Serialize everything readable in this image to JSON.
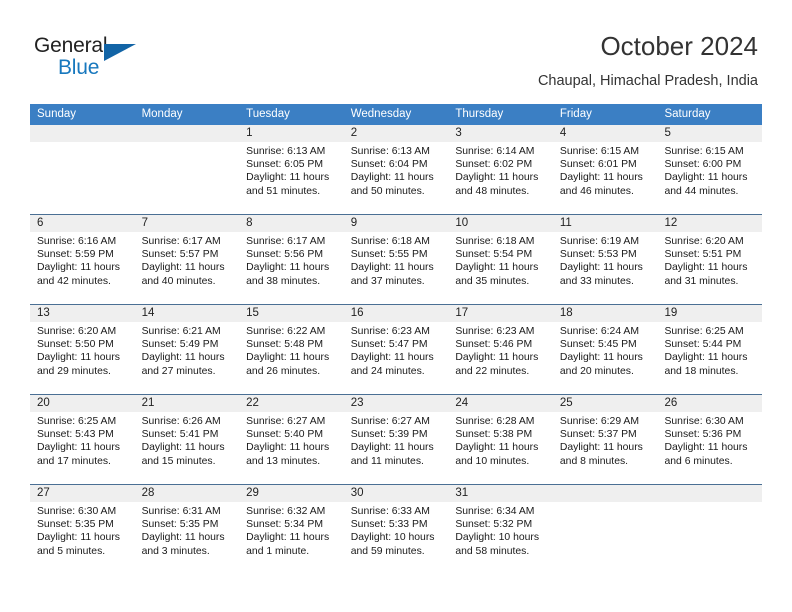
{
  "brand": {
    "name_part1": "General",
    "name_part2": "Blue",
    "logo_icon": "triangle-logo-icon"
  },
  "header": {
    "title": "October 2024",
    "subtitle": "Chaupal, Himachal Pradesh, India"
  },
  "colors": {
    "header_blue": "#3b7fc4",
    "brand_blue": "#1878be",
    "logo_blue": "#1264a6",
    "daynum_band": "#efefef",
    "row_divider": "#4a6f94",
    "text": "#1a1a1a"
  },
  "calendar": {
    "day_headers": [
      "Sunday",
      "Monday",
      "Tuesday",
      "Wednesday",
      "Thursday",
      "Friday",
      "Saturday"
    ],
    "weeks": [
      [
        {
          "day": "",
          "empty": true
        },
        {
          "day": "",
          "empty": true
        },
        {
          "day": "1",
          "sunrise": "Sunrise: 6:13 AM",
          "sunset": "Sunset: 6:05 PM",
          "daylight": "Daylight: 11 hours and 51 minutes."
        },
        {
          "day": "2",
          "sunrise": "Sunrise: 6:13 AM",
          "sunset": "Sunset: 6:04 PM",
          "daylight": "Daylight: 11 hours and 50 minutes."
        },
        {
          "day": "3",
          "sunrise": "Sunrise: 6:14 AM",
          "sunset": "Sunset: 6:02 PM",
          "daylight": "Daylight: 11 hours and 48 minutes."
        },
        {
          "day": "4",
          "sunrise": "Sunrise: 6:15 AM",
          "sunset": "Sunset: 6:01 PM",
          "daylight": "Daylight: 11 hours and 46 minutes."
        },
        {
          "day": "5",
          "sunrise": "Sunrise: 6:15 AM",
          "sunset": "Sunset: 6:00 PM",
          "daylight": "Daylight: 11 hours and 44 minutes."
        }
      ],
      [
        {
          "day": "6",
          "sunrise": "Sunrise: 6:16 AM",
          "sunset": "Sunset: 5:59 PM",
          "daylight": "Daylight: 11 hours and 42 minutes."
        },
        {
          "day": "7",
          "sunrise": "Sunrise: 6:17 AM",
          "sunset": "Sunset: 5:57 PM",
          "daylight": "Daylight: 11 hours and 40 minutes."
        },
        {
          "day": "8",
          "sunrise": "Sunrise: 6:17 AM",
          "sunset": "Sunset: 5:56 PM",
          "daylight": "Daylight: 11 hours and 38 minutes."
        },
        {
          "day": "9",
          "sunrise": "Sunrise: 6:18 AM",
          "sunset": "Sunset: 5:55 PM",
          "daylight": "Daylight: 11 hours and 37 minutes."
        },
        {
          "day": "10",
          "sunrise": "Sunrise: 6:18 AM",
          "sunset": "Sunset: 5:54 PM",
          "daylight": "Daylight: 11 hours and 35 minutes."
        },
        {
          "day": "11",
          "sunrise": "Sunrise: 6:19 AM",
          "sunset": "Sunset: 5:53 PM",
          "daylight": "Daylight: 11 hours and 33 minutes."
        },
        {
          "day": "12",
          "sunrise": "Sunrise: 6:20 AM",
          "sunset": "Sunset: 5:51 PM",
          "daylight": "Daylight: 11 hours and 31 minutes."
        }
      ],
      [
        {
          "day": "13",
          "sunrise": "Sunrise: 6:20 AM",
          "sunset": "Sunset: 5:50 PM",
          "daylight": "Daylight: 11 hours and 29 minutes."
        },
        {
          "day": "14",
          "sunrise": "Sunrise: 6:21 AM",
          "sunset": "Sunset: 5:49 PM",
          "daylight": "Daylight: 11 hours and 27 minutes."
        },
        {
          "day": "15",
          "sunrise": "Sunrise: 6:22 AM",
          "sunset": "Sunset: 5:48 PM",
          "daylight": "Daylight: 11 hours and 26 minutes."
        },
        {
          "day": "16",
          "sunrise": "Sunrise: 6:23 AM",
          "sunset": "Sunset: 5:47 PM",
          "daylight": "Daylight: 11 hours and 24 minutes."
        },
        {
          "day": "17",
          "sunrise": "Sunrise: 6:23 AM",
          "sunset": "Sunset: 5:46 PM",
          "daylight": "Daylight: 11 hours and 22 minutes."
        },
        {
          "day": "18",
          "sunrise": "Sunrise: 6:24 AM",
          "sunset": "Sunset: 5:45 PM",
          "daylight": "Daylight: 11 hours and 20 minutes."
        },
        {
          "day": "19",
          "sunrise": "Sunrise: 6:25 AM",
          "sunset": "Sunset: 5:44 PM",
          "daylight": "Daylight: 11 hours and 18 minutes."
        }
      ],
      [
        {
          "day": "20",
          "sunrise": "Sunrise: 6:25 AM",
          "sunset": "Sunset: 5:43 PM",
          "daylight": "Daylight: 11 hours and 17 minutes."
        },
        {
          "day": "21",
          "sunrise": "Sunrise: 6:26 AM",
          "sunset": "Sunset: 5:41 PM",
          "daylight": "Daylight: 11 hours and 15 minutes."
        },
        {
          "day": "22",
          "sunrise": "Sunrise: 6:27 AM",
          "sunset": "Sunset: 5:40 PM",
          "daylight": "Daylight: 11 hours and 13 minutes."
        },
        {
          "day": "23",
          "sunrise": "Sunrise: 6:27 AM",
          "sunset": "Sunset: 5:39 PM",
          "daylight": "Daylight: 11 hours and 11 minutes."
        },
        {
          "day": "24",
          "sunrise": "Sunrise: 6:28 AM",
          "sunset": "Sunset: 5:38 PM",
          "daylight": "Daylight: 11 hours and 10 minutes."
        },
        {
          "day": "25",
          "sunrise": "Sunrise: 6:29 AM",
          "sunset": "Sunset: 5:37 PM",
          "daylight": "Daylight: 11 hours and 8 minutes."
        },
        {
          "day": "26",
          "sunrise": "Sunrise: 6:30 AM",
          "sunset": "Sunset: 5:36 PM",
          "daylight": "Daylight: 11 hours and 6 minutes."
        }
      ],
      [
        {
          "day": "27",
          "sunrise": "Sunrise: 6:30 AM",
          "sunset": "Sunset: 5:35 PM",
          "daylight": "Daylight: 11 hours and 5 minutes."
        },
        {
          "day": "28",
          "sunrise": "Sunrise: 6:31 AM",
          "sunset": "Sunset: 5:35 PM",
          "daylight": "Daylight: 11 hours and 3 minutes."
        },
        {
          "day": "29",
          "sunrise": "Sunrise: 6:32 AM",
          "sunset": "Sunset: 5:34 PM",
          "daylight": "Daylight: 11 hours and 1 minute."
        },
        {
          "day": "30",
          "sunrise": "Sunrise: 6:33 AM",
          "sunset": "Sunset: 5:33 PM",
          "daylight": "Daylight: 10 hours and 59 minutes."
        },
        {
          "day": "31",
          "sunrise": "Sunrise: 6:34 AM",
          "sunset": "Sunset: 5:32 PM",
          "daylight": "Daylight: 10 hours and 58 minutes."
        },
        {
          "day": "",
          "empty": true
        },
        {
          "day": "",
          "empty": true
        }
      ]
    ]
  }
}
